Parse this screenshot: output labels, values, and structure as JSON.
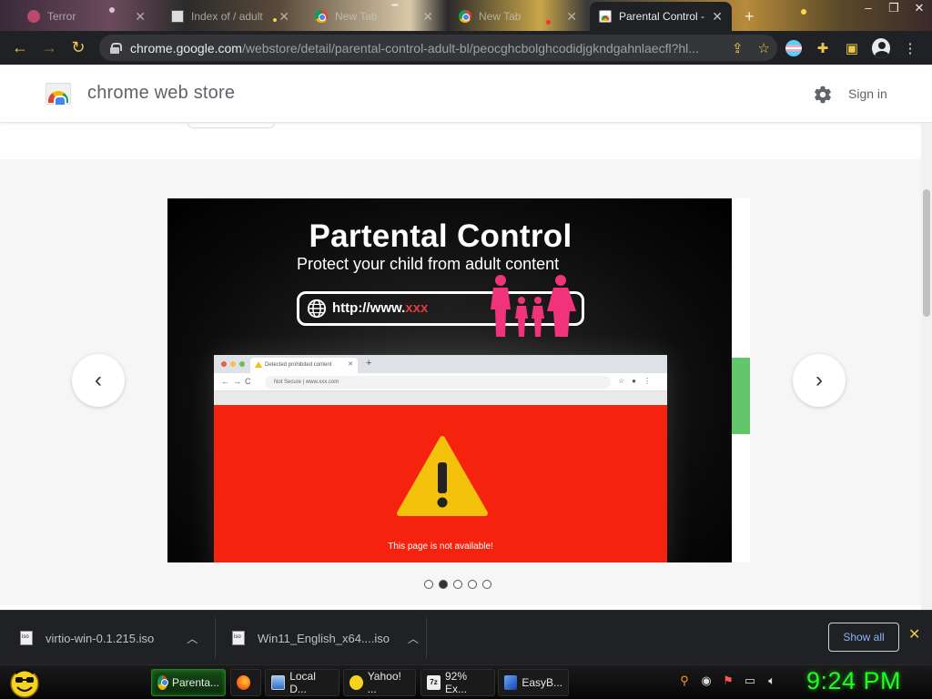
{
  "browser": {
    "tabs": [
      {
        "title": "Terror",
        "icon": "skull-icon"
      },
      {
        "title": "Index of / adult",
        "icon": "folder-icon"
      },
      {
        "title": "New Tab",
        "icon": "chrome-icon"
      },
      {
        "title": "New Tab",
        "icon": "chrome-icon"
      },
      {
        "title": "Parental Control -",
        "icon": "chrome-web-store-icon",
        "active": true
      }
    ],
    "url_host": "chrome.google.com",
    "url_path": "/webstore/detail/parental-control-adult-bl/peocghcbolghcodidjgkndgahnlaecfl?hl...",
    "window_controls": [
      "–",
      "❐",
      "✕"
    ]
  },
  "store": {
    "title": "chrome web store",
    "sign_in": "Sign in"
  },
  "slide": {
    "title": "Partental Control",
    "subtitle": "Protect your child from adult content",
    "url_prefix": "http://www.",
    "url_xxx": "xxx",
    "mock_tab_title": "Detected prohibited content",
    "mock_address": "Not Secure  |  www.xxx.com",
    "blocked_message": "This page is not available!",
    "warning_color": "#f5220d"
  },
  "carousel": {
    "slide_count": 5,
    "active_index": 1,
    "prev_icon": "‹",
    "next_icon": "›"
  },
  "downloads": {
    "items": [
      {
        "name": "virtio-win-0.1.215.iso"
      },
      {
        "name": "Win11_English_x64....iso"
      }
    ],
    "show_all": "Show all"
  },
  "taskbar": {
    "tasks": [
      {
        "label": "Parenta...",
        "icon": "chrome-icon",
        "active": true
      },
      {
        "label": "",
        "icon": "firefox-icon"
      },
      {
        "label": "Local D...",
        "icon": "drive-icon"
      },
      {
        "label": "Yahoo! ...",
        "icon": "yahoo-smiley-icon"
      },
      {
        "label": "92% Ex...",
        "icon": "7zip-icon"
      },
      {
        "label": "EasyB...",
        "icon": "easybcd-icon"
      }
    ],
    "clock": "9:24 PM"
  }
}
